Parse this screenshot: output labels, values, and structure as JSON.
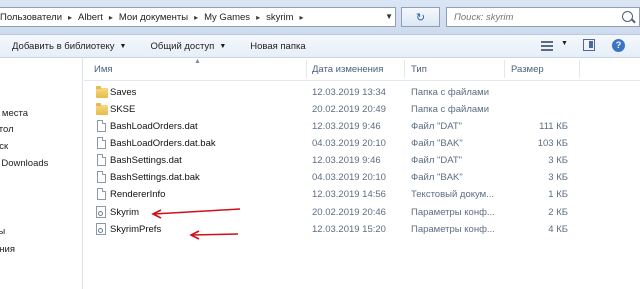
{
  "address_bar": {
    "breadcrumbs": [
      "Пользователи",
      "Albert",
      "Мои документы",
      "My Games",
      "skyrim"
    ]
  },
  "search": {
    "placeholder": "Поиск: skyrim"
  },
  "toolbar": {
    "add_to_library": "Добавить в библиотеку",
    "share": "Общий доступ",
    "new_folder": "Новая папка"
  },
  "nav_pane": {
    "items": [
      "е места",
      "стол",
      "иск",
      "c Downloads",
      "и",
      "ты",
      "ения"
    ]
  },
  "columns": {
    "name": "Имя",
    "date": "Дата изменения",
    "type": "Тип",
    "size": "Размер"
  },
  "files": [
    {
      "name": "Saves",
      "date": "12.03.2019 13:34",
      "type": "Папка с файлами",
      "size": "",
      "icon": "folder-icon"
    },
    {
      "name": "SKSE",
      "date": "20.02.2019 20:49",
      "type": "Папка с файлами",
      "size": "",
      "icon": "folder-icon"
    },
    {
      "name": "BashLoadOrders.dat",
      "date": "12.03.2019 9:46",
      "type": "Файл \"DAT\"",
      "size": "111 КБ",
      "icon": "file-icon"
    },
    {
      "name": "BashLoadOrders.dat.bak",
      "date": "04.03.2019 20:10",
      "type": "Файл \"BAK\"",
      "size": "103 КБ",
      "icon": "file-icon"
    },
    {
      "name": "BashSettings.dat",
      "date": "12.03.2019 9:46",
      "type": "Файл \"DAT\"",
      "size": "3 КБ",
      "icon": "file-icon"
    },
    {
      "name": "BashSettings.dat.bak",
      "date": "04.03.2019 20:10",
      "type": "Файл \"BAK\"",
      "size": "3 КБ",
      "icon": "file-icon"
    },
    {
      "name": "RendererInfo",
      "date": "12.03.2019 14:56",
      "type": "Текстовый докум...",
      "size": "1 КБ",
      "icon": "text-file-icon"
    },
    {
      "name": "Skyrim",
      "date": "20.02.2019 20:46",
      "type": "Параметры конф...",
      "size": "2 КБ",
      "icon": "config-file-icon"
    },
    {
      "name": "SkyrimPrefs",
      "date": "12.03.2019 15:20",
      "type": "Параметры конф...",
      "size": "4 КБ",
      "icon": "config-file-icon"
    }
  ],
  "colors": {
    "annotation_arrow": "#d0101a",
    "selection_header": "#4c607a"
  }
}
